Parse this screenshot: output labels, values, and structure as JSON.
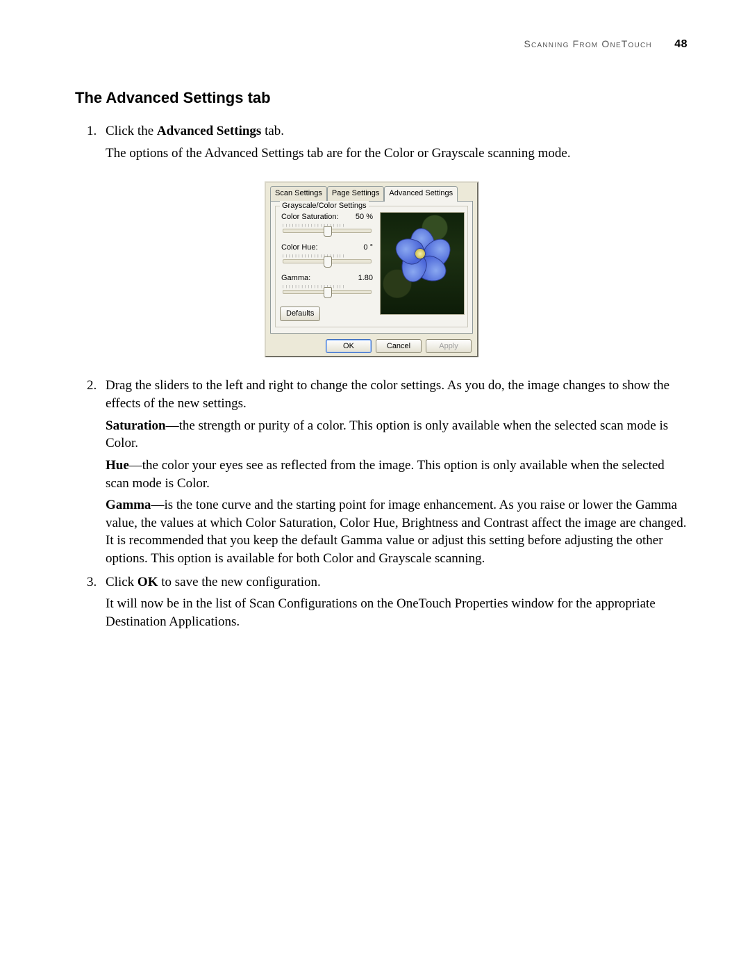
{
  "header": {
    "section": "Scanning From OneTouch",
    "page_number": "48"
  },
  "section_title": "The Advanced Settings tab",
  "steps": {
    "s1_a": "Click the ",
    "s1_bold": "Advanced Settings",
    "s1_b": " tab.",
    "s1_line2": "The options of the Advanced Settings tab are for the Color or Grayscale scanning mode.",
    "s2_line1": "Drag the sliders to the left and right to change the color settings. As you do, the image changes to show the effects of the new settings.",
    "s2_sat_label": "Saturation",
    "s2_sat_text": "—the strength or purity of a color. This option is only available when the selected scan mode is Color.",
    "s2_hue_label": "Hue",
    "s2_hue_text": "—the color your eyes see as reflected from the image. This option is only available when the selected scan mode is Color.",
    "s2_gamma_label": "Gamma",
    "s2_gamma_text": "—is the tone curve and the starting point for image enhancement. As you raise or lower the Gamma value, the values at which Color Saturation, Color Hue, Brightness and Contrast affect the image are changed. It is recommended that you keep the default Gamma value or adjust this setting before adjusting the other options. This option is available for both Color and Grayscale scanning.",
    "s3_a": "Click ",
    "s3_bold": "OK",
    "s3_b": " to save the new configuration.",
    "s3_line2": "It will now be in the list of Scan Configurations on the OneTouch Properties window for the appropriate Destination Applications."
  },
  "dialog": {
    "tabs": {
      "scan": "Scan Settings",
      "page": "Page Settings",
      "advanced": "Advanced Settings"
    },
    "group_legend": "Grayscale/Color Settings",
    "saturation": {
      "label": "Color Saturation:",
      "value": "50 %"
    },
    "hue": {
      "label": "Color Hue:",
      "value": "0 °"
    },
    "gamma": {
      "label": "Gamma:",
      "value": "1.80"
    },
    "defaults_btn": "Defaults",
    "buttons": {
      "ok": "OK",
      "cancel": "Cancel",
      "apply": "Apply"
    }
  }
}
